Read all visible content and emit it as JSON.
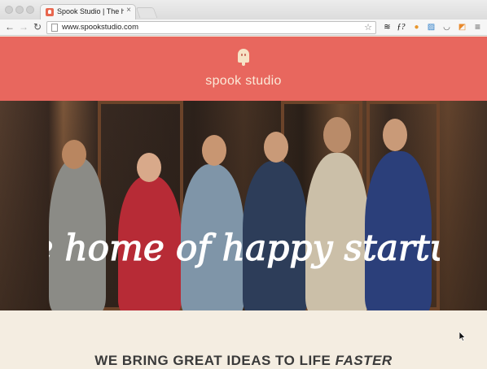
{
  "browser": {
    "tab_title": "Spook Studio | The home o",
    "tab_close": "×",
    "url": "www.spookstudio.com",
    "nav": {
      "back": "←",
      "forward": "→",
      "reload": "↻"
    },
    "star": "☆",
    "extensions": [
      {
        "name": "layers-icon",
        "glyph": "≋",
        "color": "#333333"
      },
      {
        "name": "font-icon",
        "glyph": "ƒ?",
        "color": "#222222"
      },
      {
        "name": "cookie-icon",
        "glyph": "●",
        "color": "#e8962c"
      },
      {
        "name": "stripes-icon",
        "glyph": "▨",
        "color": "#2f7fc8"
      },
      {
        "name": "pocket-icon",
        "glyph": "◡",
        "color": "#555555"
      },
      {
        "name": "feed-icon",
        "glyph": "◩",
        "color": "#e8892c"
      },
      {
        "name": "menu-icon",
        "glyph": "≡",
        "color": "#555555"
      }
    ]
  },
  "page": {
    "brand": "spook studio",
    "tagline": "the home of happy startups",
    "cta_text": "WE BRING GREAT IDEAS TO LIFE ",
    "cta_emphasis": "FASTER",
    "colors": {
      "header": "#e8675e",
      "cream": "#f4ede1",
      "brand_text": "#fbe9d8"
    }
  }
}
